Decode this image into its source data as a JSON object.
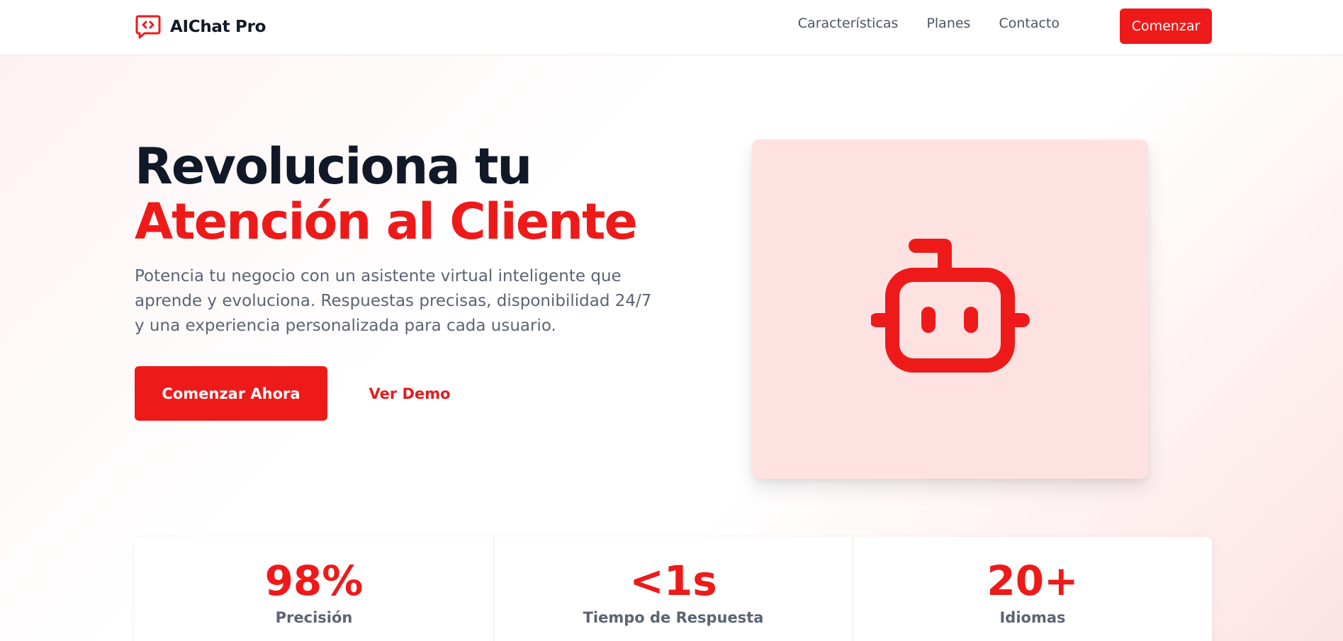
{
  "brand": {
    "name": "AIChat Pro",
    "accent_color": "#ee1a1a",
    "logo_icon": "chat-bubble-code-icon"
  },
  "nav": {
    "links": [
      "Características",
      "Planes",
      "Contacto"
    ],
    "cta_label": "Comenzar"
  },
  "hero": {
    "title_line1": "Revoluciona tu",
    "title_line2": "Atención al Cliente",
    "subtitle": "Potencia tu negocio con un asistente virtual inteligente que aprende y evoluciona. Respuestas precisas, disponibilidad 24/7 y una experiencia personalizada para cada usuario.",
    "primary_button": "Comenzar Ahora",
    "secondary_button": "Ver Demo",
    "illustration_icon": "robot-icon"
  },
  "stats": [
    {
      "value": "98%",
      "label": "Precisión"
    },
    {
      "value": "<1s",
      "label": "Tiempo de Respuesta"
    },
    {
      "value": "20+",
      "label": "Idiomas"
    }
  ]
}
